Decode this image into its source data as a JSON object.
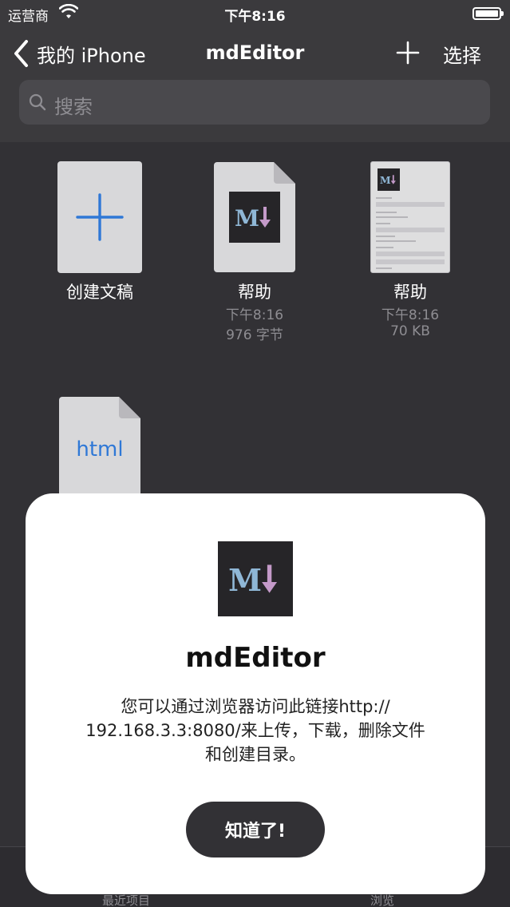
{
  "status_bar": {
    "carrier": "运营商",
    "time": "下午8:16"
  },
  "nav": {
    "back_label": "我的 iPhone",
    "title": "mdEditor",
    "select_label": "选择"
  },
  "search": {
    "placeholder": "搜索"
  },
  "files": [
    {
      "name": "创建文稿"
    },
    {
      "name": "帮助",
      "time": "下午8:16",
      "size": "976 字节"
    },
    {
      "name": "帮助",
      "time": "下午8:16",
      "size": "70 KB"
    },
    {
      "name": "",
      "type_label": "html"
    }
  ],
  "tab_bar": {
    "recent_label": "最近项目",
    "browse_label": "浏览"
  },
  "dialog": {
    "title": "mdEditor",
    "message_line1": "您可以通过浏览器访问此链接http://",
    "message_line2": "192.168.3.3:8080/来上传，下载，删除文件",
    "message_line3": "和创建目录。",
    "ok_label": "知道了!"
  },
  "colors": {
    "background": "#3b3a3d",
    "accent": "#2f78d6",
    "dialog_button": "#323135"
  }
}
